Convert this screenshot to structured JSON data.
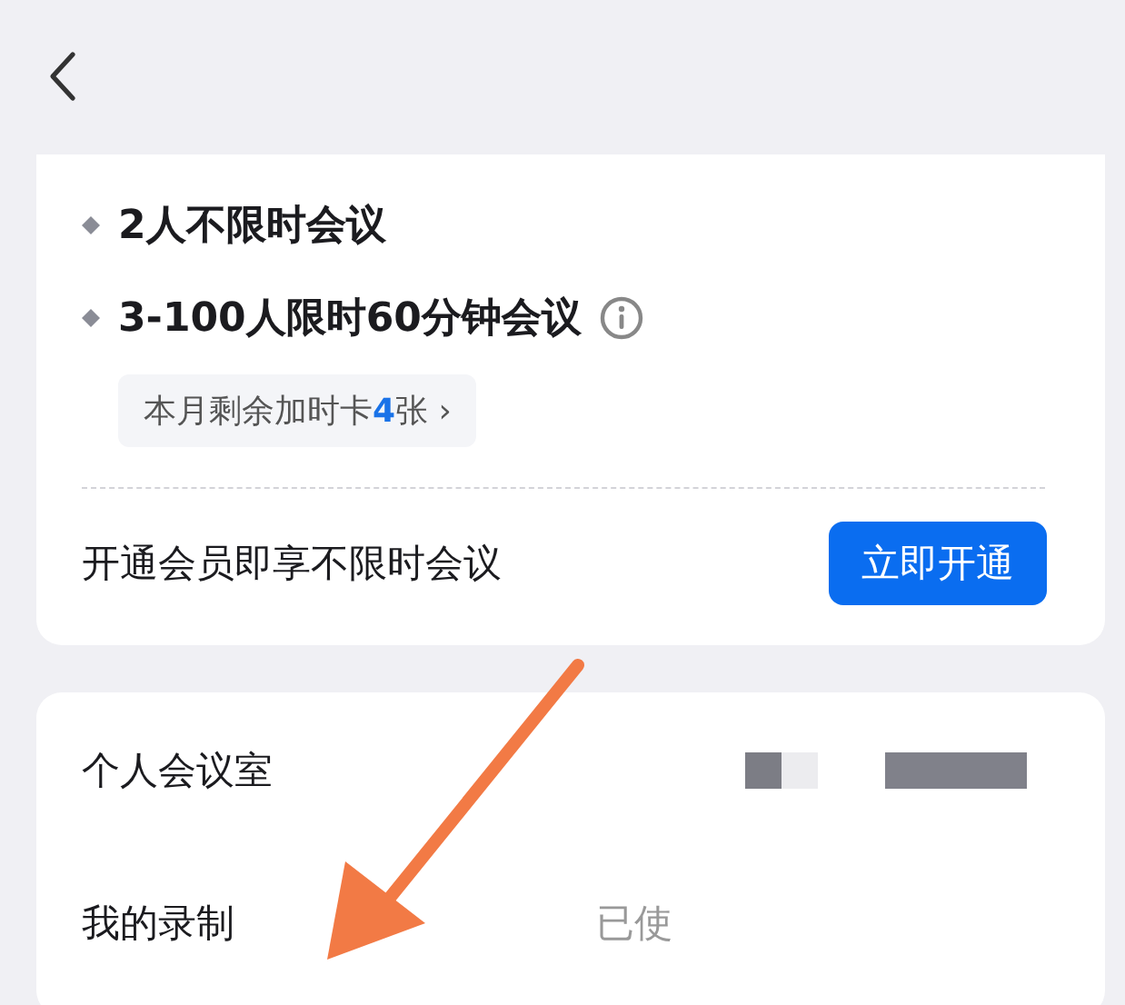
{
  "features": [
    {
      "text": "2人不限时会议",
      "info": false
    },
    {
      "text": "3-100人限时60分钟会议",
      "info": true
    }
  ],
  "card_chip": {
    "text": "本月剩余加时卡**4**张",
    "chevron": "›"
  },
  "upgrade": {
    "text": "开通会员即享不限时会议",
    "button": "立即开通"
  },
  "rows": [
    {
      "label": "个人会议室",
      "kind": "redacted"
    },
    {
      "label": "我的录制",
      "kind": "value",
      "value": "已使"
    }
  ]
}
